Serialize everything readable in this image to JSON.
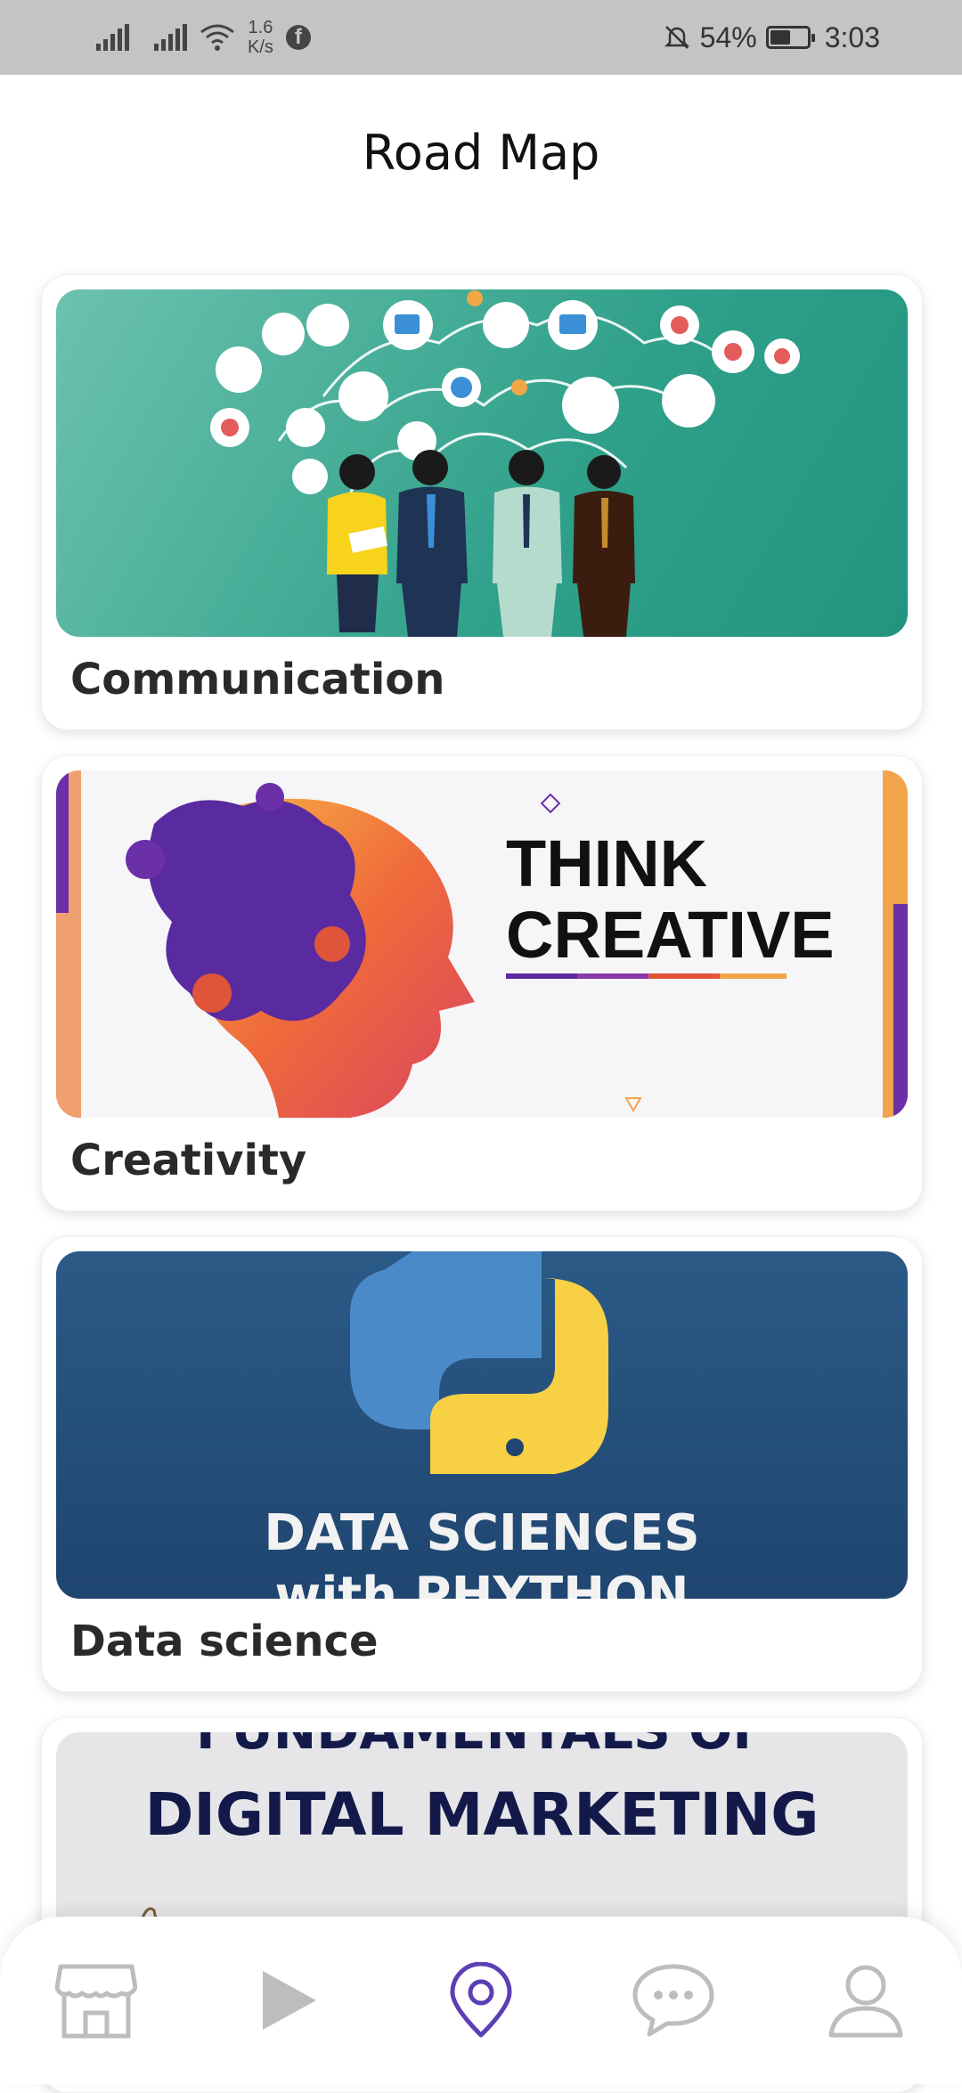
{
  "status": {
    "speed": "1.6",
    "speed_unit": "K/s",
    "battery": "54%",
    "time": "3:03",
    "battery_level": 0.54
  },
  "header": {
    "title": "Road Map"
  },
  "cards": [
    {
      "label": "Communication"
    },
    {
      "label": "Creativity",
      "image_text": [
        "THINK",
        "CREATIVE"
      ]
    },
    {
      "label": "Data science",
      "image_text": [
        "DATA SCIENCES",
        "with PHYTHON"
      ]
    },
    {
      "image_text": [
        "FUNDAMENTALS OF",
        "DIGITAL MARKETING"
      ]
    }
  ],
  "nav": [
    {
      "icon": "store-icon"
    },
    {
      "icon": "play-icon"
    },
    {
      "icon": "map-pin-icon",
      "active": true
    },
    {
      "icon": "chat-icon"
    },
    {
      "icon": "profile-icon"
    }
  ],
  "colors": {
    "accent": "#5b3fb3",
    "nav_inactive": "#bdbdbd"
  }
}
